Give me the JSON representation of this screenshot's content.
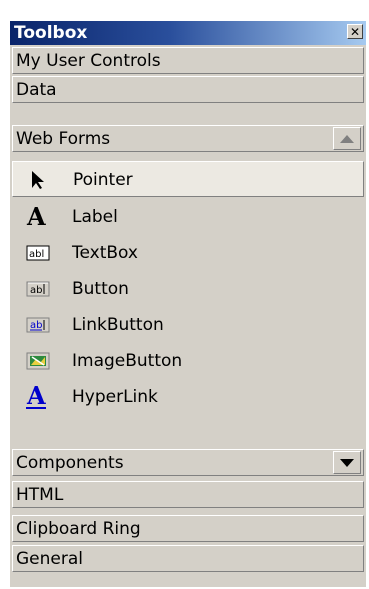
{
  "toolbox": {
    "title": "Toolbox",
    "close_icon": "close-icon"
  },
  "tabs": [
    {
      "label": "My User Controls",
      "expanded": false
    },
    {
      "label": "Data",
      "expanded": false
    },
    {
      "label": "Web Forms",
      "expanded": true,
      "arrow": "scroll-up-icon"
    }
  ],
  "web_forms_items": [
    {
      "label": "Pointer",
      "icon": "pointer-icon",
      "selected": true
    },
    {
      "label": "Label",
      "icon": "label-icon"
    },
    {
      "label": "TextBox",
      "icon": "textbox-icon"
    },
    {
      "label": "Button",
      "icon": "button-icon"
    },
    {
      "label": "LinkButton",
      "icon": "linkbutton-icon"
    },
    {
      "label": "ImageButton",
      "icon": "imagebutton-icon"
    },
    {
      "label": "HyperLink",
      "icon": "hyperlink-icon"
    }
  ],
  "lower_tabs": [
    {
      "label": "Components",
      "arrow": "scroll-down-icon"
    },
    {
      "label": "HTML"
    },
    {
      "label": "Clipboard Ring"
    },
    {
      "label": "General"
    }
  ],
  "colors": {
    "title_gradient_start": "#0a246a",
    "title_gradient_end": "#a6caf0",
    "panel_bg": "#d4d0c8",
    "link_blue": "#0000cc"
  }
}
